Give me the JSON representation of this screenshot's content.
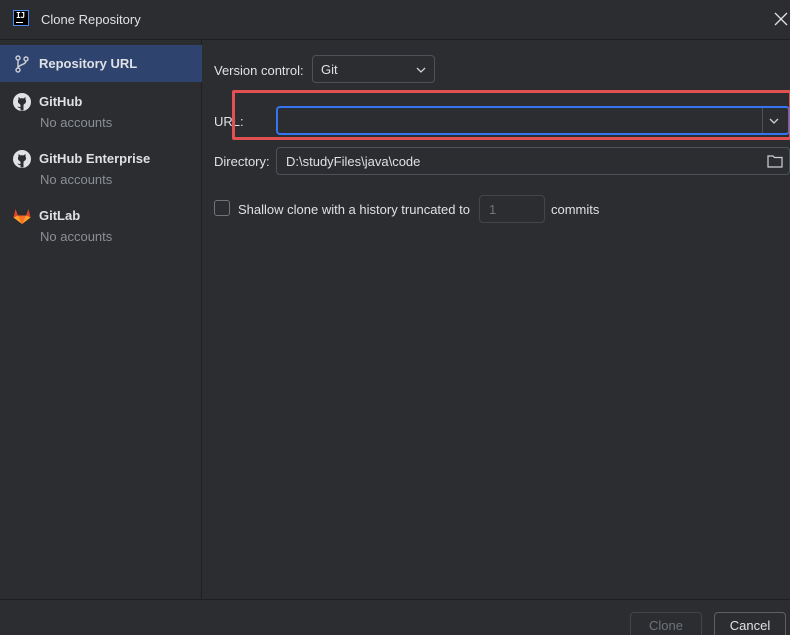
{
  "window": {
    "title": "Clone Repository"
  },
  "sidebar": {
    "items": [
      {
        "label": "Repository URL",
        "sub": ""
      },
      {
        "label": "GitHub",
        "sub": "No accounts"
      },
      {
        "label": "GitHub Enterprise",
        "sub": "No accounts"
      },
      {
        "label": "GitLab",
        "sub": "No accounts"
      }
    ]
  },
  "form": {
    "version_control": {
      "label": "Version control:",
      "value": "Git"
    },
    "url": {
      "label": "URL:",
      "value": ""
    },
    "directory": {
      "label": "Directory:",
      "value": "D:\\studyFiles\\java\\code"
    },
    "shallow": {
      "label": "Shallow clone with a history truncated to",
      "value": "1",
      "suffix": "commits",
      "checked": false
    }
  },
  "footer": {
    "clone_label": "Clone",
    "cancel_label": "Cancel"
  },
  "colors": {
    "accent": "#3574f0",
    "selection": "#2e436e",
    "highlight": "#e25151",
    "gitlab": "#e24329"
  }
}
